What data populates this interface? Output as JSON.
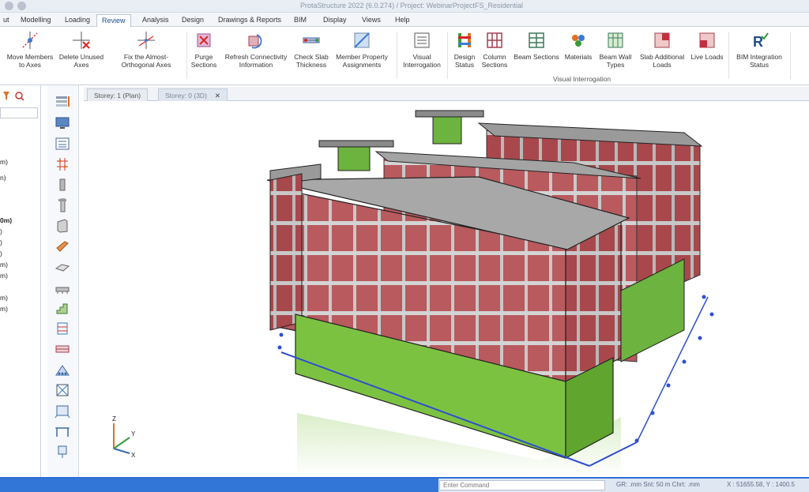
{
  "window": {
    "title": "ProtaStructure 2022 (6.0.274) / Project: WebinarProjectFS_Residential"
  },
  "menu": {
    "tabs": [
      "ut",
      "Modelling",
      "Loading",
      "Review",
      "Analysis",
      "Design",
      "Drawings & Reports",
      "BIM",
      "Display",
      "Views",
      "Help"
    ],
    "active": "Review"
  },
  "ribbon": {
    "buttons": [
      {
        "label": "Move Members to Axes",
        "icon": "move-members-icon"
      },
      {
        "label": "Delete Unused Axes",
        "icon": "delete-axes-icon"
      },
      {
        "label": "Fix the Almost-Orthogonal Axes",
        "icon": "fix-axes-icon"
      },
      {
        "label": "Purge Sections",
        "icon": "purge-sections-icon"
      },
      {
        "label": "Refresh Connectivity Information",
        "icon": "refresh-connectivity-icon"
      },
      {
        "label": "Check Slab Thickness",
        "icon": "check-slab-icon"
      },
      {
        "label": "Member Property Assignments",
        "icon": "member-property-icon"
      },
      {
        "label": "Visual Interrogation",
        "icon": "visual-interrogation-icon"
      },
      {
        "label": "Design Status",
        "icon": "design-status-icon"
      },
      {
        "label": "Column Sections",
        "icon": "column-sections-icon"
      },
      {
        "label": "Beam Sections",
        "icon": "beam-sections-icon"
      },
      {
        "label": "Materials",
        "icon": "materials-icon"
      },
      {
        "label": "Beam Wall Types",
        "icon": "beam-wall-types-icon"
      },
      {
        "label": "Slab Additional Loads",
        "icon": "slab-loads-icon"
      },
      {
        "label": "Live Loads",
        "icon": "live-loads-icon"
      },
      {
        "label": "BIM Integration Status",
        "icon": "bim-integration-icon"
      }
    ],
    "group_label": "Visual Interrogation"
  },
  "left_panel": {
    "items": [
      "m)",
      "n)",
      "0m)",
      ")",
      ")",
      ")",
      "m)",
      "m)",
      "m)",
      "m)"
    ]
  },
  "doc_tabs": [
    {
      "label": "Storey: 1 (Plan)"
    },
    {
      "label": "Storey: 0 (3D)",
      "close": "✕"
    }
  ],
  "axis": {
    "z": "Z",
    "y": "Y",
    "x": "X"
  },
  "status": {
    "command_placeholder": "Enter Command",
    "right_text_1": "GR: .mm    Snt: 50 m    Chrt: .mm",
    "right_text_2": "X : 51655.58, Y : 1400.5"
  },
  "colors": {
    "accent": "#2d6fd6",
    "slab": "#9a9a9a",
    "infill": "#b85a5e",
    "ground_wall": "#7cc241",
    "grid": "#2e4fd0"
  }
}
